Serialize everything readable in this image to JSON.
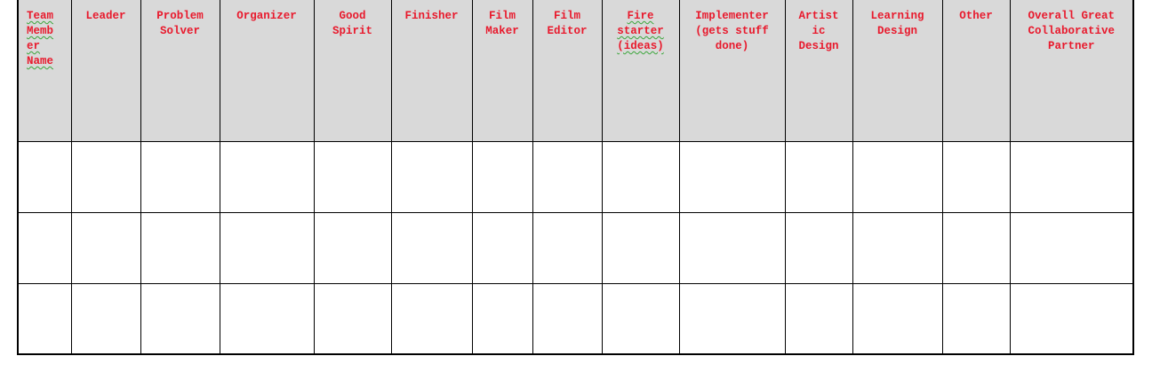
{
  "table": {
    "headers": [
      "Team\nMemb\ner\nName",
      "Leader",
      "Problem\nSolver",
      "Organizer",
      "Good\nSpirit",
      "Finisher",
      "Film\nMaker",
      "Film\nEditor",
      "Fire\nstarter\n(ideas)",
      "Implementer\n(gets stuff\ndone)",
      "Artist\nic\nDesign",
      "Learning\nDesign",
      "Other",
      "Overall Great\nCollaborative\nPartner"
    ],
    "rows": [
      [
        "",
        "",
        "",
        "",
        "",
        "",
        "",
        "",
        "",
        "",
        "",
        "",
        "",
        ""
      ],
      [
        "",
        "",
        "",
        "",
        "",
        "",
        "",
        "",
        "",
        "",
        "",
        "",
        "",
        ""
      ],
      [
        "",
        "",
        "",
        "",
        "",
        "",
        "",
        "",
        "",
        "",
        "",
        "",
        "",
        ""
      ]
    ]
  },
  "colors": {
    "header_text": "#e8192c",
    "header_background": "#d9d9d9",
    "grid": "#000000",
    "spellcheck_underline": "#3aa53a"
  }
}
